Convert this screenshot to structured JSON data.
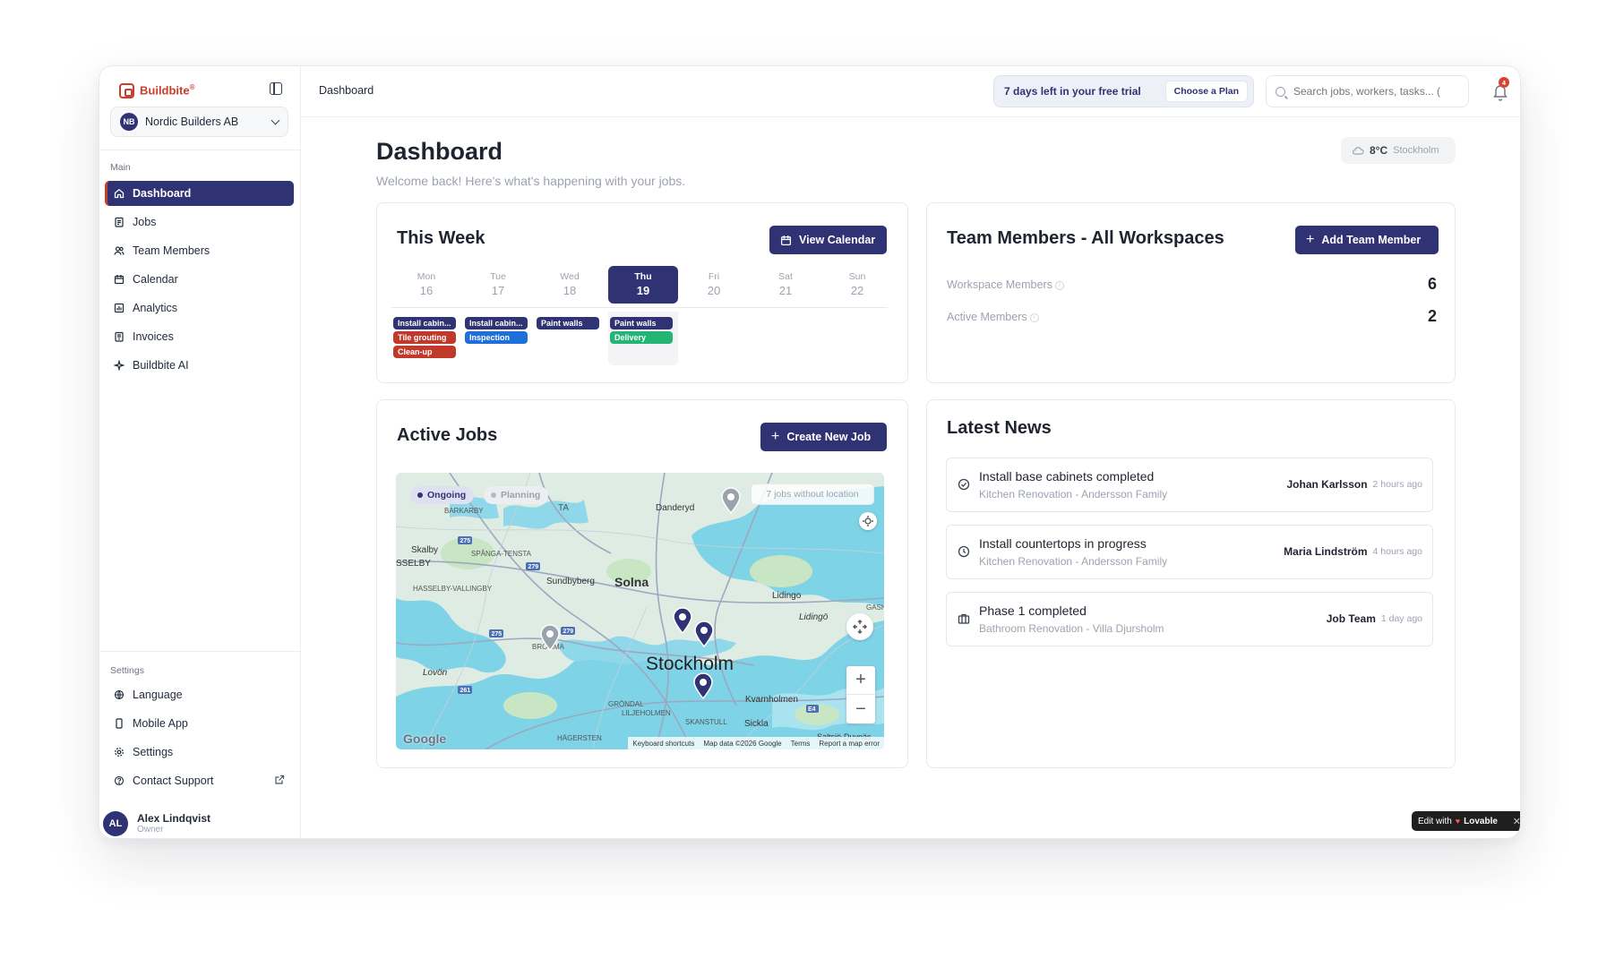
{
  "brand": {
    "name": "Buildbite",
    "reg": "®"
  },
  "workspace": {
    "initials": "NB",
    "name": "Nordic Builders AB"
  },
  "sidebar": {
    "main_label": "Main",
    "items": [
      {
        "label": "Dashboard",
        "icon": "home-icon",
        "active": true
      },
      {
        "label": "Jobs",
        "icon": "clipboard-icon"
      },
      {
        "label": "Team Members",
        "icon": "users-icon"
      },
      {
        "label": "Calendar",
        "icon": "calendar-icon"
      },
      {
        "label": "Analytics",
        "icon": "bar-chart-icon"
      },
      {
        "label": "Invoices",
        "icon": "receipt-icon"
      },
      {
        "label": "Buildbite AI",
        "icon": "sparkles-icon"
      }
    ],
    "settings_label": "Settings",
    "settings_items": [
      {
        "label": "Language",
        "icon": "globe-icon"
      },
      {
        "label": "Mobile App",
        "icon": "smartphone-icon"
      },
      {
        "label": "Settings",
        "icon": "gear-icon"
      },
      {
        "label": "Contact Support",
        "icon": "help-circle-icon"
      }
    ]
  },
  "user": {
    "initials": "AL",
    "name": "Alex Lindqvist",
    "role": "Owner"
  },
  "topbar": {
    "breadcrumb": "Dashboard",
    "trial_text": "7 days left in your free trial",
    "trial_button": "Choose a Plan",
    "search_placeholder": "Search jobs, workers, tasks... (",
    "notification_count": "4"
  },
  "header": {
    "title": "Dashboard",
    "subtitle": "Welcome back! Here's what's happening with your jobs.",
    "weather_temp": "8°C",
    "weather_city": "Stockholm"
  },
  "this_week": {
    "title": "This Week",
    "button": "View Calendar",
    "days": [
      {
        "name": "Mon",
        "date": "16"
      },
      {
        "name": "Tue",
        "date": "17"
      },
      {
        "name": "Wed",
        "date": "18"
      },
      {
        "name": "Thu",
        "date": "19",
        "today": true
      },
      {
        "name": "Fri",
        "date": "20"
      },
      {
        "name": "Sat",
        "date": "21"
      },
      {
        "name": "Sun",
        "date": "22"
      }
    ],
    "tasks": [
      {
        "day": 0,
        "row": 0,
        "label": "Install cabin...",
        "color": "#2f3273"
      },
      {
        "day": 0,
        "row": 1,
        "label": "Tile grouting",
        "color": "#c0392b"
      },
      {
        "day": 0,
        "row": 2,
        "label": "Clean-up",
        "color": "#c0392b"
      },
      {
        "day": 1,
        "row": 0,
        "label": "Install cabin...",
        "color": "#2f3273"
      },
      {
        "day": 1,
        "row": 1,
        "label": "Inspection",
        "color": "#1e6fd9"
      },
      {
        "day": 2,
        "row": 0,
        "label": "Paint walls",
        "color": "#2f3273"
      },
      {
        "day": 3,
        "row": 0,
        "label": "Paint walls",
        "color": "#2f3273"
      },
      {
        "day": 3,
        "row": 1,
        "label": "Delivery",
        "color": "#22b573"
      }
    ]
  },
  "team": {
    "title": "Team Members - All Workspaces",
    "button": "Add Team Member",
    "stats": [
      {
        "label": "Workspace Members",
        "value": "6"
      },
      {
        "label": "Active Members",
        "value": "2"
      }
    ]
  },
  "active_jobs": {
    "title": "Active Jobs",
    "button": "Create New Job",
    "map": {
      "chip_ongoing": "Ongoing",
      "chip_planning": "Planning",
      "no_location": "7 jobs without location",
      "city": "Stockholm",
      "places": [
        "Danderyd",
        "Solna",
        "Sundbyberg",
        "Skalby",
        "SPÅNGA-TENSTA",
        "SSELBY",
        "HASSELBY-VALLINGBY",
        "Lidingo",
        "Lidingö",
        "BROMMA",
        "Lovön",
        "GRÖNDAL",
        "LILJEHOLMEN",
        "Kvarnholmen",
        "SKANSTULL",
        "Sickla",
        "HÄGERSTEN",
        "Saltsjö-Duvnäs",
        "BARKARBY",
        "TA",
        "GASH"
      ],
      "roads": [
        "275",
        "279",
        "275",
        "279",
        "261",
        "E4"
      ],
      "google": "Google",
      "attribution": [
        "Keyboard shortcuts",
        "Map data ©2026 Google",
        "Terms",
        "Report a map error"
      ]
    }
  },
  "news": {
    "title": "Latest News",
    "items": [
      {
        "icon": "check-circle-icon",
        "title": "Install base cabinets completed",
        "sub": "Kitchen Renovation - Andersson Family",
        "author": "Johan Karlsson",
        "time": "2 hours ago"
      },
      {
        "icon": "clock-icon",
        "title": "Install countertops in progress",
        "sub": "Kitchen Renovation - Andersson Family",
        "author": "Maria Lindström",
        "time": "4 hours ago"
      },
      {
        "icon": "briefcase-icon",
        "title": "Phase 1 completed",
        "sub": "Bathroom Renovation - Villa Djursholm",
        "author": "Job Team",
        "time": "1 day ago"
      }
    ]
  },
  "lovable": {
    "prefix": "Edit with",
    "brand": "Lovable"
  },
  "colors": {
    "primary": "#2f3273",
    "accent": "#c8402c",
    "water": "#7fd3e6",
    "land": "#dfece4"
  }
}
